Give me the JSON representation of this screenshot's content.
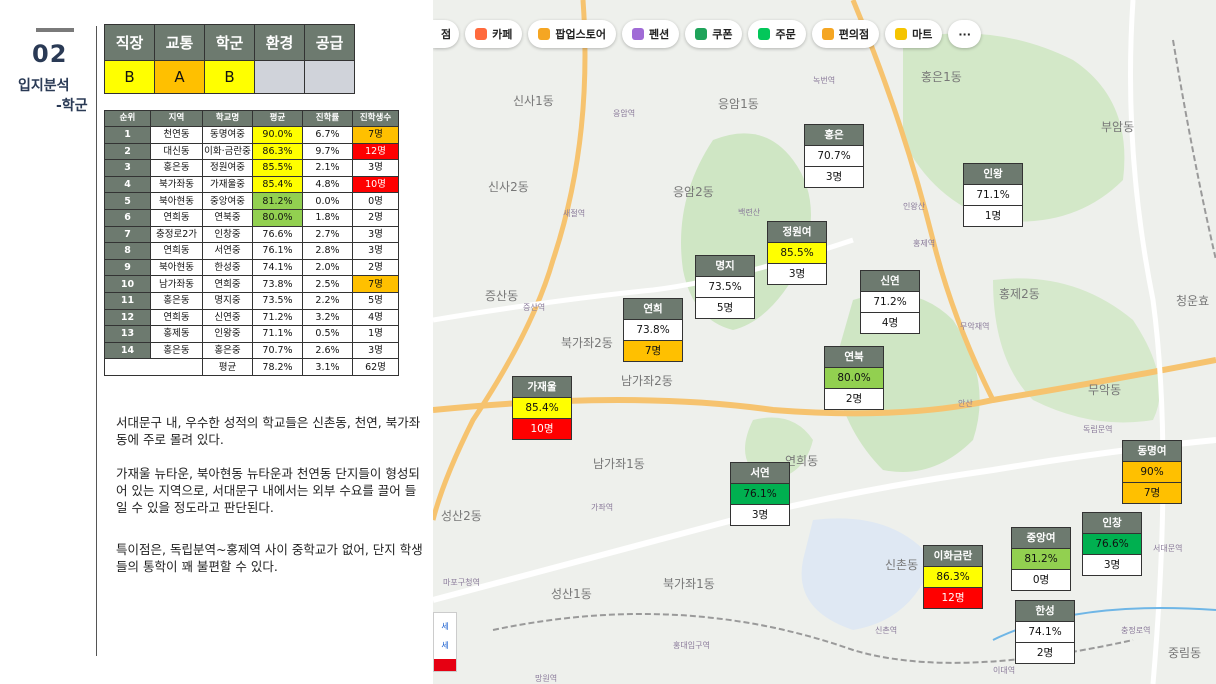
{
  "section": {
    "number": "02",
    "title_line1": "입지분석",
    "title_line2": "-학군"
  },
  "rating": {
    "headers": [
      "직장",
      "교통",
      "학군",
      "환경",
      "공급"
    ],
    "grades": [
      "B",
      "A",
      "B",
      "",
      ""
    ]
  },
  "ranking": {
    "headers": [
      "순위",
      "지역",
      "학교명",
      "평균",
      "진학률",
      "진학생수"
    ],
    "rows": [
      [
        "1",
        "천연동",
        "동명여중",
        "90.0%",
        "6.7%",
        "7명"
      ],
      [
        "2",
        "대신동",
        "이화·금란중",
        "86.3%",
        "9.7%",
        "12명"
      ],
      [
        "3",
        "홍은동",
        "정원여중",
        "85.5%",
        "2.1%",
        "3명"
      ],
      [
        "4",
        "북가좌동",
        "가재울중",
        "85.4%",
        "4.8%",
        "10명"
      ],
      [
        "5",
        "북아현동",
        "중앙여중",
        "81.2%",
        "0.0%",
        "0명"
      ],
      [
        "6",
        "연희동",
        "연북중",
        "80.0%",
        "1.8%",
        "2명"
      ],
      [
        "7",
        "충정로2가",
        "인창중",
        "76.6%",
        "2.7%",
        "3명"
      ],
      [
        "8",
        "연희동",
        "서연중",
        "76.1%",
        "2.8%",
        "3명"
      ],
      [
        "9",
        "북아현동",
        "한성중",
        "74.1%",
        "2.0%",
        "2명"
      ],
      [
        "10",
        "남가좌동",
        "연희중",
        "73.8%",
        "2.5%",
        "7명"
      ],
      [
        "11",
        "홍은동",
        "명지중",
        "73.5%",
        "2.2%",
        "5명"
      ],
      [
        "12",
        "연희동",
        "신연중",
        "71.2%",
        "3.2%",
        "4명"
      ],
      [
        "13",
        "홍제동",
        "인왕중",
        "71.1%",
        "0.5%",
        "1명"
      ],
      [
        "14",
        "홍은동",
        "홍은중",
        "70.7%",
        "2.6%",
        "3명"
      ]
    ],
    "footer": [
      "평균",
      "78.2%",
      "3.1%",
      "62명"
    ]
  },
  "description": {
    "p1": "서대문구 내, 우수한 성적의 학교들은 신촌동, 천연, 북가좌동에 주로 몰려 있다.",
    "p2": "가재울 뉴타운, 북아현동 뉴타운과 천연동 단지들이 형성되어 있는 지역으로, 서대문구 내에서는 외부 수요를 끌어 들일 수 있을 정도라고 판단된다.",
    "p3": "특이점은, 독립분역~홍제역 사이 중학교가 없어, 단지 학생들의 통학이 꽤 불편할 수 있다."
  },
  "map": {
    "toolbar": [
      "점",
      "카페",
      "팝업스토어",
      "펜션",
      "쿠폰",
      "주문",
      "편의점",
      "마트",
      "···"
    ],
    "toolbar_icon_colors": [
      "",
      "#ff6a3d",
      "#f5a623",
      "#a06bd6",
      "#1fa35a",
      "#03c75a",
      "#f5a623",
      "#f5c400",
      ""
    ],
    "district_labels": [
      "신사1동",
      "응암1동",
      "홍은1동",
      "부암동",
      "신사2동",
      "응암2동",
      "증산동",
      "북가좌2동",
      "홍제2동",
      "청운효",
      "남가좌2동",
      "무악동",
      "남가좌1동",
      "연희동",
      "성산2동",
      "신촌동",
      "성산1동",
      "중림동",
      "북가좌1동"
    ],
    "place_labels": [
      "응암역",
      "새절역",
      "증산역",
      "녹번역",
      "홍제역",
      "무악재역",
      "독립문역",
      "가좌역",
      "신촌역",
      "이대역",
      "홍대입구역",
      "마포구청역",
      "충정로역",
      "서대문역",
      "백련산",
      "안산",
      "인왕산",
      "망원역"
    ],
    "cards": [
      {
        "name": "홍은",
        "pct": "70.7%",
        "count": "3명"
      },
      {
        "name": "인왕",
        "pct": "71.1%",
        "count": "1명"
      },
      {
        "name": "정원여",
        "pct": "85.5%",
        "count": "3명"
      },
      {
        "name": "명지",
        "pct": "73.5%",
        "count": "5명"
      },
      {
        "name": "신연",
        "pct": "71.2%",
        "count": "4명"
      },
      {
        "name": "연희",
        "pct": "73.8%",
        "count": "7명"
      },
      {
        "name": "연북",
        "pct": "80.0%",
        "count": "2명"
      },
      {
        "name": "가재울",
        "pct": "85.4%",
        "count": "10명"
      },
      {
        "name": "서연",
        "pct": "76.1%",
        "count": "3명"
      },
      {
        "name": "동명여",
        "pct": "90%",
        "count": "7명"
      },
      {
        "name": "인창",
        "pct": "76.6%",
        "count": "3명"
      },
      {
        "name": "중앙여",
        "pct": "81.2%",
        "count": "0명"
      },
      {
        "name": "이화금란",
        "pct": "86.3%",
        "count": "12명"
      },
      {
        "name": "한성",
        "pct": "74.1%",
        "count": "2명"
      }
    ],
    "side_button": {
      "line1": "세",
      "line2": "세"
    }
  }
}
